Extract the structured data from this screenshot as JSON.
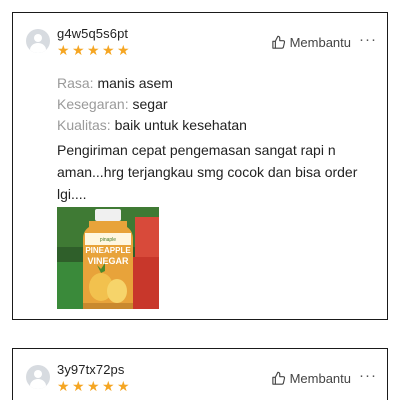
{
  "reviews": [
    {
      "username": "g4w5q5s6pt",
      "rating": 5,
      "helpful_label": "Membantu",
      "more_label": "···",
      "attributes": [
        {
          "label": "Rasa:",
          "value": "manis asem"
        },
        {
          "label": "Kesegaran:",
          "value": "segar"
        },
        {
          "label": "Kualitas:",
          "value": "baik untuk kesehatan"
        }
      ],
      "text": "Pengiriman cepat pengemasan sangat rapi n aman...hrg terjangkau smg cocok dan bisa order lgi....",
      "photo": {
        "bottle_label_line1": "PINEAPPLE",
        "bottle_label_line2": "VINEGAR"
      }
    },
    {
      "username": "3y97tx72ps",
      "rating": 5,
      "helpful_label": "Membantu",
      "more_label": "···"
    }
  ],
  "colors": {
    "star": "#f5a623",
    "attr_label": "#9a9a9a",
    "border": "#1a1a1a"
  },
  "icons": {
    "avatar": "user-avatar-icon",
    "helpful": "thumbs-up-icon",
    "more": "more-dots-icon",
    "star": "star-icon"
  }
}
